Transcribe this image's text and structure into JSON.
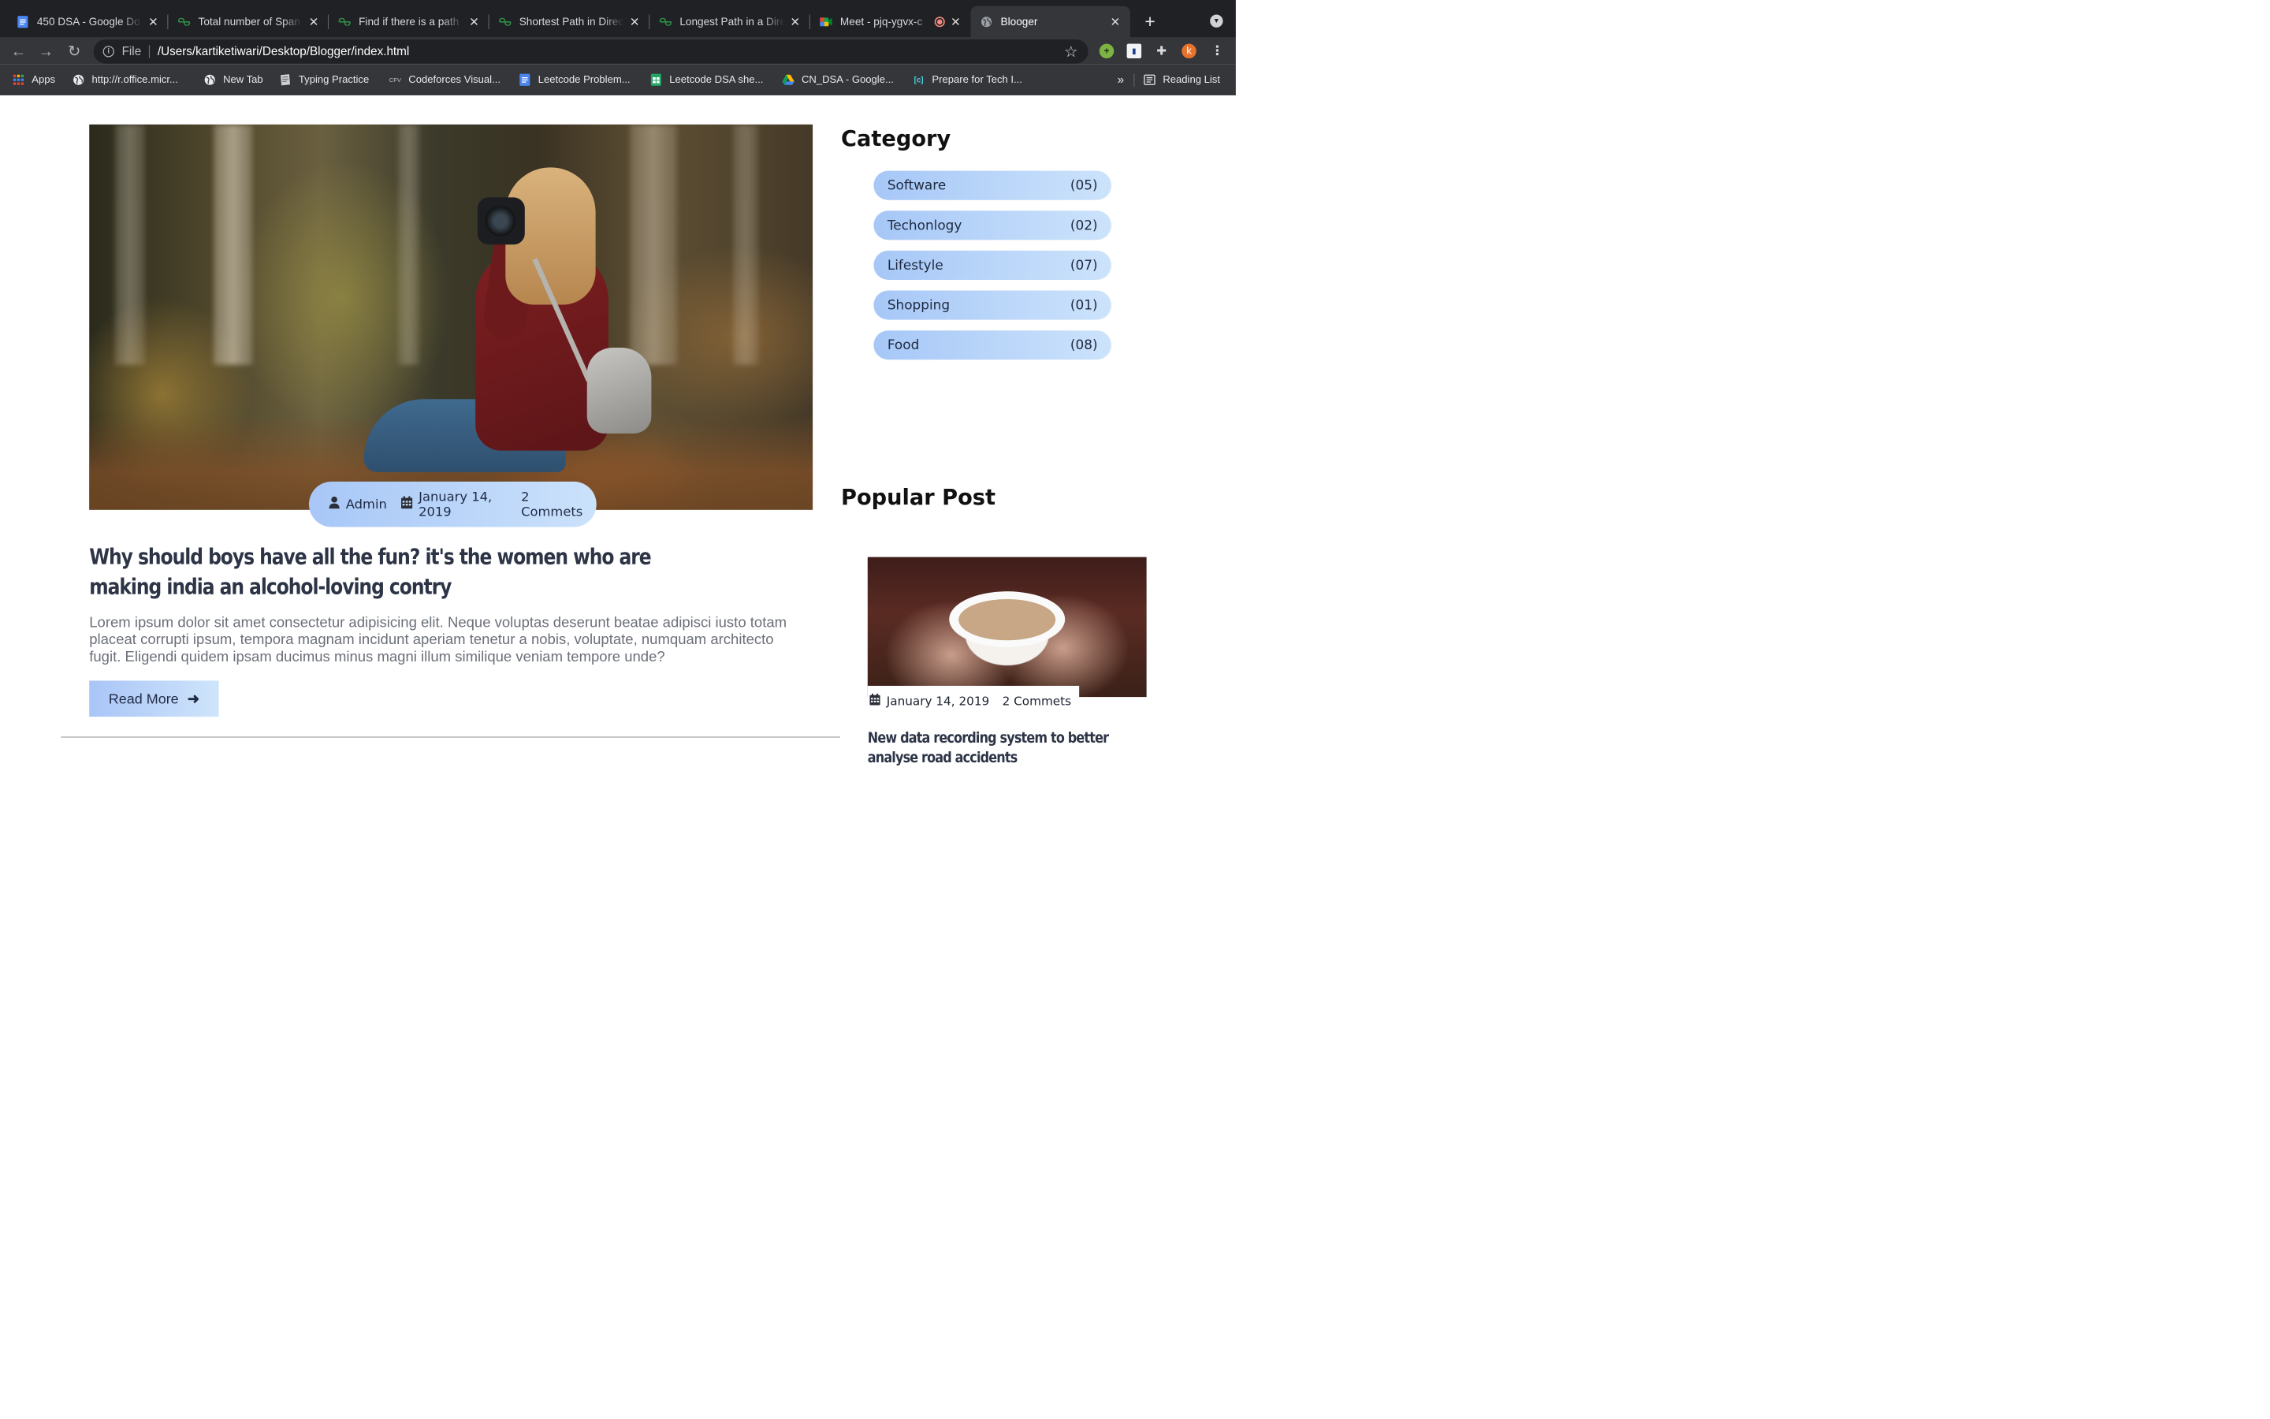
{
  "browser": {
    "tabs": [
      {
        "title": "450 DSA - Google Do",
        "favicon": "google-docs-icon"
      },
      {
        "title": "Total number of Span",
        "favicon": "geeksforgeeks-icon"
      },
      {
        "title": "Find if there is a path",
        "favicon": "geeksforgeeks-icon"
      },
      {
        "title": "Shortest Path in Direc",
        "favicon": "geeksforgeeks-icon"
      },
      {
        "title": "Longest Path in a Dire",
        "favicon": "geeksforgeeks-icon"
      },
      {
        "title": "Meet - pjq-ygvx-c",
        "favicon": "google-meet-icon"
      },
      {
        "title": "Blooger",
        "favicon": "globe-icon"
      }
    ],
    "close_glyph": "✕",
    "new_tab_glyph": "+",
    "address": {
      "scheme_label": "File",
      "url": "/Users/kartiketiwari/Desktop/Blogger/index.html"
    },
    "profile_initial": "k",
    "bookmarks": [
      {
        "label": "Apps",
        "icon": "apps-grid-icon"
      },
      {
        "label": "http://r.office.micr...",
        "icon": "globe-icon"
      },
      {
        "label": "New Tab",
        "icon": "globe-icon"
      },
      {
        "label": "Typing Practice",
        "icon": "page-icon"
      },
      {
        "label": "Codeforces Visual...",
        "icon": "cfv-icon"
      },
      {
        "label": "Leetcode Problem...",
        "icon": "google-docs-icon"
      },
      {
        "label": "Leetcode DSA she...",
        "icon": "google-sheets-icon"
      },
      {
        "label": "CN_DSA - Google...",
        "icon": "google-drive-icon"
      },
      {
        "label": "Prepare for Tech I...",
        "icon": "code-bracket-icon"
      }
    ],
    "cfv_badge": "CFV",
    "code_badge": "[c]",
    "overflow_glyph": "»",
    "reading_list": "Reading List"
  },
  "post": {
    "meta": {
      "author": "Admin",
      "date": "January 14, 2019",
      "comments": "2 Commets"
    },
    "title": "Why should boys have all the fun? it's the women who are making india an alcohol-loving contry",
    "excerpt": "Lorem ipsum dolor sit amet consectetur adipisicing elit. Neque voluptas deserunt beatae adipisci iusto totam placeat corrupti ipsum, tempora magnam incidunt aperiam tenetur a nobis, voluptate, numquam architecto fugit. Eligendi quidem ipsam ducimus minus magni illum similique veniam tempore unde?",
    "read_more": "Read More",
    "read_more_arrow": "➜"
  },
  "sidebar": {
    "category_heading": "Category",
    "categories": [
      {
        "name": "Software",
        "count": "(05)"
      },
      {
        "name": "Techonlogy",
        "count": "(02)"
      },
      {
        "name": "Lifestyle",
        "count": "(07)"
      },
      {
        "name": "Shopping",
        "count": "(01)"
      },
      {
        "name": "Food",
        "count": "(08)"
      }
    ],
    "popular_heading": "Popular Post",
    "popular": {
      "date": "January 14, 2019",
      "comments": "2 Commets",
      "title": "New data recording system to better analyse road accidents"
    }
  },
  "colors": {
    "accent_gradient_start": "#a8c7f7",
    "accent_gradient_end": "#cbe2fb",
    "title_text": "#2c3446",
    "chrome_dark": "#202124"
  }
}
